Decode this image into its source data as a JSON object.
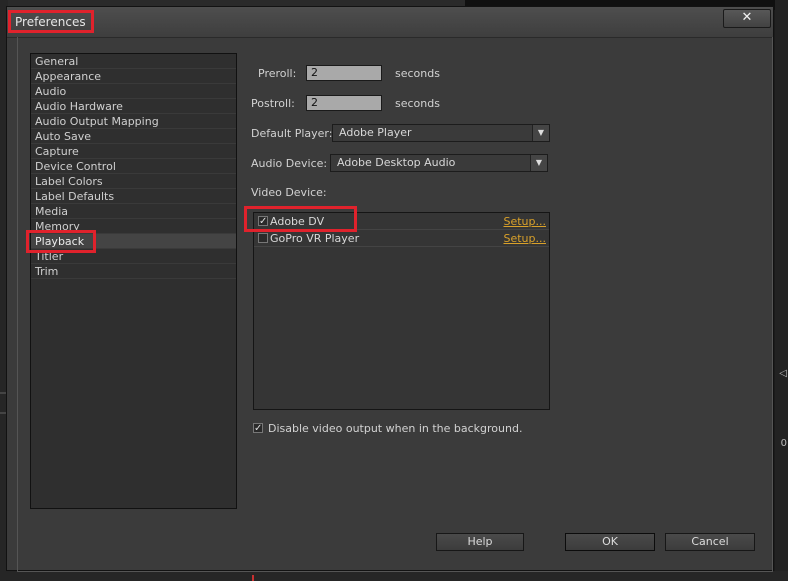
{
  "dialog": {
    "title": "Preferences",
    "close_label": "✕"
  },
  "categories": [
    {
      "label": "General",
      "selected": false
    },
    {
      "label": "Appearance",
      "selected": false
    },
    {
      "label": "Audio",
      "selected": false
    },
    {
      "label": "Audio Hardware",
      "selected": false
    },
    {
      "label": "Audio Output Mapping",
      "selected": false
    },
    {
      "label": "Auto Save",
      "selected": false
    },
    {
      "label": "Capture",
      "selected": false
    },
    {
      "label": "Device Control",
      "selected": false
    },
    {
      "label": "Label Colors",
      "selected": false
    },
    {
      "label": "Label Defaults",
      "selected": false
    },
    {
      "label": "Media",
      "selected": false
    },
    {
      "label": "Memory",
      "selected": false
    },
    {
      "label": "Playback",
      "selected": true
    },
    {
      "label": "Titler",
      "selected": false
    },
    {
      "label": "Trim",
      "selected": false
    }
  ],
  "playback": {
    "preroll_label": "Preroll:",
    "preroll_value": "2",
    "preroll_unit": "seconds",
    "postroll_label": "Postroll:",
    "postroll_value": "2",
    "postroll_unit": "seconds",
    "default_player_label": "Default Player:",
    "default_player_value": "Adobe Player",
    "audio_device_label": "Audio Device:",
    "audio_device_value": "Adobe Desktop Audio",
    "video_device_label": "Video Device:",
    "video_devices": [
      {
        "name": "Adobe DV",
        "checked": true,
        "setup_label": "Setup..."
      },
      {
        "name": "GoPro VR Player",
        "checked": false,
        "setup_label": "Setup..."
      }
    ],
    "disable_background_label": "Disable video output when in the background.",
    "disable_background_checked": true
  },
  "buttons": {
    "help": "Help",
    "ok": "OK",
    "cancel": "Cancel"
  },
  "colors": {
    "highlight": "#e0222c",
    "setup_link": "#d9a12a",
    "selected_row": "#444444"
  }
}
